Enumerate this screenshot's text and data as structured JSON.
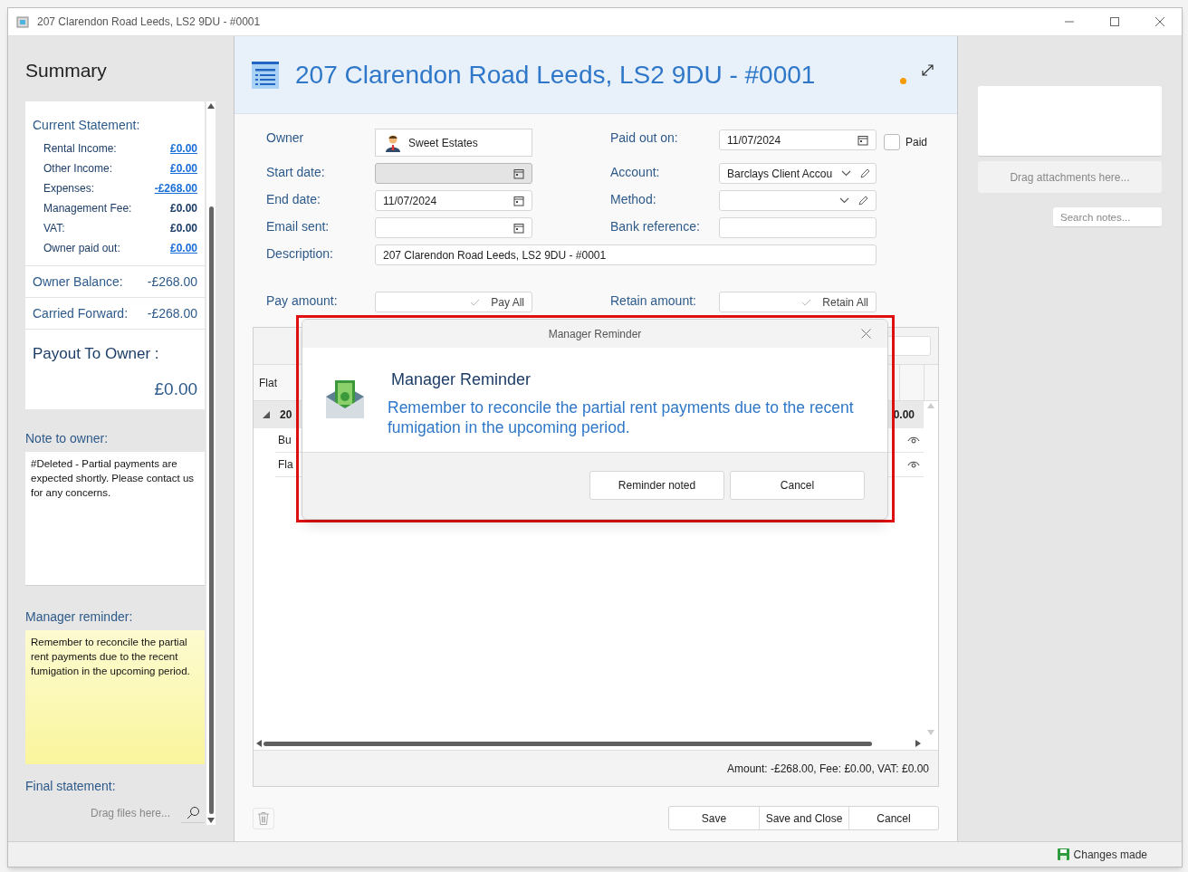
{
  "window": {
    "title": "207 Clarendon Road Leeds, LS2 9DU - #0001"
  },
  "summary": {
    "title": "Summary",
    "statement_label": "Current Statement:",
    "lines": [
      {
        "label": "Rental Income:",
        "value": "£0.00",
        "link": true
      },
      {
        "label": "Other Income:",
        "value": "£0.00",
        "link": true
      },
      {
        "label": "Expenses:",
        "value": "-£268.00",
        "link": true
      },
      {
        "label": "Management Fee:",
        "value": "£0.00",
        "link": false
      },
      {
        "label": "VAT:",
        "value": "£0.00",
        "link": false
      },
      {
        "label": "Owner paid out:",
        "value": "£0.00",
        "link": true
      }
    ],
    "totals": [
      {
        "label": "Owner Balance:",
        "value": "-£268.00"
      },
      {
        "label": "Carried Forward:",
        "value": "-£268.00"
      }
    ],
    "payout": {
      "label": "Payout To Owner :",
      "value": "£0.00"
    },
    "note_label": "Note to owner:",
    "note": "#Deleted - Partial payments are expected shortly. Please contact us for any concerns.",
    "reminder_label": "Manager reminder:",
    "reminder": "Remember to reconcile the partial rent payments due to the recent fumigation in the upcoming period.",
    "final_label": "Final statement:",
    "drag_hint": "Drag files here..."
  },
  "header": {
    "title": "207 Clarendon Road Leeds, LS2 9DU - #0001",
    "unsaved": true
  },
  "form": {
    "owner": {
      "label": "Owner",
      "value": "Sweet Estates"
    },
    "left_fields": [
      {
        "label": "Start date:",
        "disabled": true
      },
      {
        "label": "End date:",
        "value": "11/07/2024",
        "disabled": false
      },
      {
        "label": "Email sent:",
        "disabled": false
      }
    ],
    "paid_out": {
      "label": "Paid out on:",
      "value": "11/07/2024"
    },
    "paid": {
      "label": "Paid",
      "checked": false
    },
    "right_fields": [
      {
        "label": "Account:",
        "value": "Barclays Client Accou",
        "kind": "select"
      },
      {
        "label": "Method:",
        "kind": "select"
      },
      {
        "label": "Bank reference:",
        "kind": "text"
      }
    ],
    "description": {
      "label": "Description:",
      "value": "207 Clarendon Road Leeds, LS2 9DU - #0001"
    },
    "pay": {
      "label": "Pay amount:",
      "button": "Pay All"
    },
    "retain": {
      "label": "Retain amount:",
      "button": "Retain All"
    }
  },
  "table": {
    "column_1": "Flat",
    "group": {
      "label": "20",
      "total": "0.00",
      "expanded": true
    },
    "rows": [
      {
        "cell": "Bu"
      },
      {
        "cell": "Fla"
      }
    ],
    "summary": "Amount: -£268.00, Fee: £0.00, VAT: £0.00"
  },
  "actions": [
    "Save",
    "Save and Close",
    "Cancel"
  ],
  "attachments": {
    "drop_hint": "Drag attachments here...",
    "search_placeholder": "Search notes..."
  },
  "status_bar": {
    "text": "Changes made"
  },
  "dialog": {
    "title": "Manager Reminder",
    "heading": "Manager Reminder",
    "message": "Remember to reconcile the partial rent payments due to the recent fumigation in the upcoming period.",
    "buttons": [
      "Reminder noted",
      "Cancel"
    ],
    "highlighted": true
  }
}
